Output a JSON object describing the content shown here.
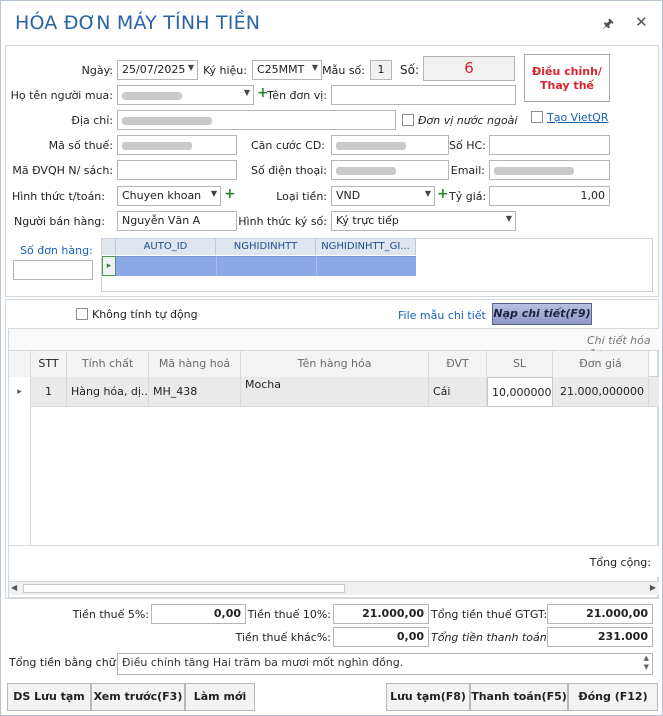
{
  "window": {
    "title": "HÓA ĐƠN MÁY TÍNH TIỀN",
    "pin_icon": "pin-icon",
    "close_icon": "close-icon"
  },
  "form": {
    "ngay_label": "Ngày:",
    "ngay_value": "25/07/2025",
    "ky_hieu_label": "Ký hiệu:",
    "ky_hieu_value": "C25MMT",
    "mau_so_label": "Mẫu số:",
    "mau_so_value": "1",
    "so_label": "Số:",
    "so_value": "6",
    "adjust_button": "Điều chỉnh/ Thay thế",
    "ho_ten_label": "Họ tên người mua:",
    "ten_don_vi_label": "Tên đơn vị:",
    "dia_chi_label": "Địa chỉ:",
    "don_vi_nuoc_ngoai": "Đơn vị nước ngoài",
    "tao_vietqr": "Tạo VietQR",
    "ma_so_thue_label": "Mã số thuế:",
    "can_cuoc_label": "Căn cước CD:",
    "so_hc_label": "Số HC:",
    "ma_dvqh_label": "Mã ĐVQH N/ sách:",
    "so_dien_thoai_label": "Số điện thoại:",
    "email_label": "Email:",
    "hinh_thuc_tt_label": "Hình thức t/toán:",
    "hinh_thuc_tt_value": "Chuyen khoan",
    "loai_tien_label": "Loại tiền:",
    "loai_tien_value": "VND",
    "ty_gia_label": "Tỷ giá:",
    "ty_gia_value": "1,00",
    "nguoi_ban_label": "Người bán hàng:",
    "nguoi_ban_value": "Nguyễn Văn A",
    "hinh_thuc_ky_label": "Hình thức ký số:",
    "hinh_thuc_ky_value": "Ký trực tiếp",
    "so_don_hang_label": "Số đơn hàng:"
  },
  "mini_grid": {
    "columns": [
      "AUTO_ID",
      "NGHIDINHTT",
      "NGHIDINHTT_GI..."
    ]
  },
  "detail": {
    "khong_tinh_tu_dong": "Không tính tự động",
    "file_mau": "File mẫu chi tiết",
    "nap_chi_tiet": "Nạp chi tiết(F9)",
    "chi_tiet_hoa_don": "Chi tiết hóa đơ",
    "columns": [
      "STT",
      "Tính chất",
      "Mã hàng hoá",
      "Tên hàng hóa",
      "ĐVT",
      "SL",
      "Đơn giá"
    ],
    "rows": [
      {
        "stt": "1",
        "tinh_chat": "Hàng hóa, dị...",
        "ma_hang": "MH_438",
        "ten_hang": "Mocha",
        "dvt": "Cái",
        "sl": "10,000000",
        "don_gia": "21.000,000000"
      }
    ],
    "tong_cong": "Tổng cộng:"
  },
  "totals": {
    "tien_thue_5_label": "Tiền thuế 5%:",
    "tien_thue_5_value": "0,00",
    "tien_thue_10_label": "Tiền thuế 10%:",
    "tien_thue_10_value": "21.000,00",
    "tong_tien_thue_label": "Tổng tiền thuế GTGT:",
    "tong_tien_thue_value": "21.000,00",
    "tien_thue_khac_label": "Tiền thuế khác%:",
    "tien_thue_khac_value": "0,00",
    "tong_thanh_toan_label": "Tổng tiền thanh toán:",
    "tong_thanh_toan_value": "231.000",
    "bang_chu_label": "Tổng tiền bằng chữ:",
    "bang_chu_value": "Điều chỉnh tăng Hai trăm ba mươi mốt nghìn đồng."
  },
  "buttons": {
    "ds_luu_tam": "DS Lưu tạm",
    "xem_truoc": "Xem trước(F3)",
    "lam_moi": "Làm mới",
    "luu_tam": "Lưu tạm(F8)",
    "thanh_toan": "Thanh toán(F5)",
    "dong": "Đóng (F12)"
  },
  "colors": {
    "title": "#2a63a8",
    "accent_red": "#d9232d",
    "grid_header_text": "#1b4f8f",
    "selected_row": "#8aa9e6"
  }
}
